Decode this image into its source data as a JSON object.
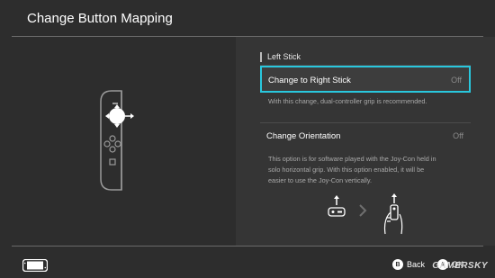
{
  "header": {
    "title": "Change Button Mapping"
  },
  "panel": {
    "section_label": "Left Stick",
    "options": [
      {
        "name": "Change to Right Stick",
        "value": "Off",
        "description": [
          "With this change, dual-controller grip is recommended."
        ]
      },
      {
        "name": "Change Orientation",
        "value": "Off",
        "description": [
          "This option is for software played with the Joy-Con held in",
          "solo horizontal grip. With this option enabled, it will be",
          "easier to use the Joy-Con vertically."
        ]
      }
    ]
  },
  "controller": {
    "stick_letter": "L"
  },
  "footer": {
    "back_key": "B",
    "back_label": "Back",
    "ok_key": "A",
    "ok_label": "OK"
  },
  "watermark": "GAMERSKY",
  "colors": {
    "accent": "#29c7dd",
    "background": "#2d2d2d",
    "panel": "#353535"
  }
}
